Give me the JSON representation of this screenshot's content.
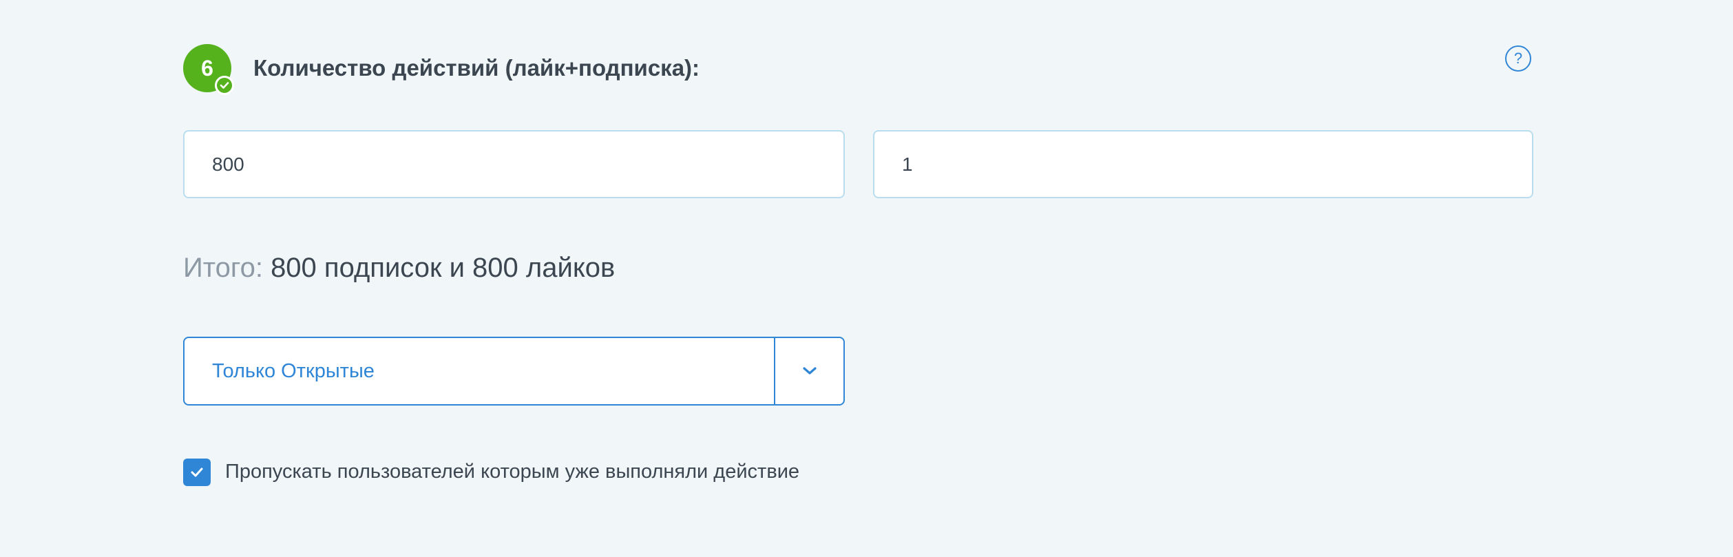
{
  "step": {
    "number": "6",
    "title": "Количество действий (лайк+подписка):",
    "completed": true,
    "badge_color": "#55b21c"
  },
  "help": {
    "label": "?"
  },
  "inputs": {
    "actions_count": "800",
    "multiplier": "1"
  },
  "total": {
    "label": "Итого:",
    "value": "800 подписок и 800 лайков"
  },
  "account_filter": {
    "selected": "Только Открытые"
  },
  "skip_checkbox": {
    "checked": true,
    "label": "Пропускать пользователей которым уже выполняли действие"
  },
  "colors": {
    "accent": "#2f86d6",
    "success": "#55b21c",
    "background": "#f1f6f9",
    "text": "#3b4650",
    "muted": "#8d99a4"
  }
}
